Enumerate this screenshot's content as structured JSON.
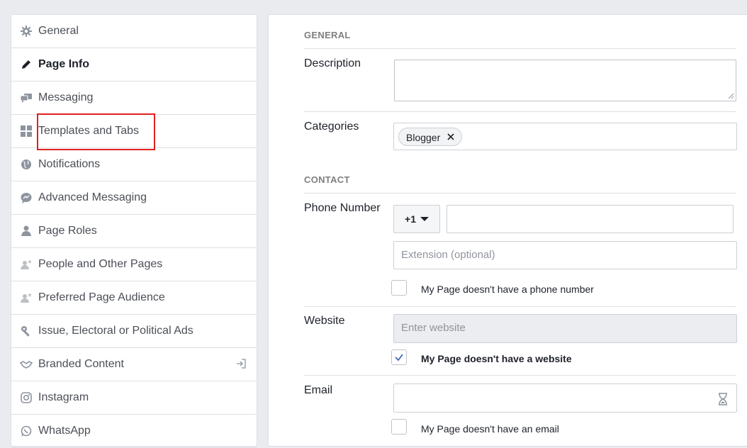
{
  "sidebar": {
    "items": [
      {
        "label": "General",
        "icon": "gear-icon",
        "active": false
      },
      {
        "label": "Page Info",
        "icon": "pencil-icon",
        "active": true
      },
      {
        "label": "Messaging",
        "icon": "chat-bubbles-icon",
        "active": false
      },
      {
        "label": "Templates and Tabs",
        "icon": "grid-icon",
        "active": false
      },
      {
        "label": "Notifications",
        "icon": "globe-icon",
        "active": false
      },
      {
        "label": "Advanced Messaging",
        "icon": "messenger-icon",
        "active": false
      },
      {
        "label": "Page Roles",
        "icon": "person-icon",
        "active": false
      },
      {
        "label": "People and Other Pages",
        "icon": "person-star-icon",
        "active": false
      },
      {
        "label": "Preferred Page Audience",
        "icon": "person-star-icon",
        "active": false
      },
      {
        "label": "Issue, Electoral or Political Ads",
        "icon": "wrench-icon",
        "active": false
      },
      {
        "label": "Branded Content",
        "icon": "handshake-icon",
        "active": false
      },
      {
        "label": "Instagram",
        "icon": "instagram-icon",
        "active": false
      },
      {
        "label": "WhatsApp",
        "icon": "whatsapp-icon",
        "active": false
      }
    ]
  },
  "main": {
    "general_heading": "GENERAL",
    "description_label": "Description",
    "description_value": "",
    "categories_label": "Categories",
    "category_tag": "Blogger",
    "contact_heading": "CONTACT",
    "phone_label": "Phone Number",
    "country_code": "+1",
    "phone_value": "",
    "extension_placeholder": "Extension (optional)",
    "no_phone_label": "My Page doesn't have a phone number",
    "no_phone_checked": false,
    "website_label": "Website",
    "website_placeholder": "Enter website",
    "no_website_label": "My Page doesn't have a website",
    "no_website_checked": true,
    "email_label": "Email",
    "email_value": "",
    "no_email_label": "My Page doesn't have an email",
    "no_email_checked": false
  },
  "colors": {
    "highlight": "#e02020",
    "check": "#4267b2",
    "border": "#dddfe2"
  }
}
